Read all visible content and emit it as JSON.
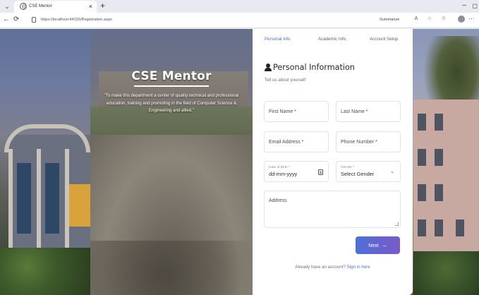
{
  "browser": {
    "tab_title": "CSE Mentor",
    "tab_close": "×",
    "new_tab": "+",
    "url": "https://localhost:44316/Registration.aspx",
    "summarize": "Summarize",
    "minimize": "–",
    "maximize": "◻",
    "back": "←",
    "refresh": "⟳",
    "tab_menu": "⌄",
    "more": "···"
  },
  "hero": {
    "title": "CSE Mentor",
    "tagline": "\"To make this department a center of quality technical and professional education, training and promoting in the field of Computer Science & Engineering and allied.\""
  },
  "steps": [
    "Personal Info",
    "Academic Info",
    "Account Setup"
  ],
  "form": {
    "section_title": "Personal Information",
    "section_subtitle": "Tell us about yourself",
    "first_name": "First Name *",
    "last_name": "Last Name *",
    "email": "Email Address *",
    "phone": "Phone Number *",
    "dob_label": "Date of Birth *",
    "dob_value": "dd-mm-yyyy",
    "gender_label": "Gender *",
    "gender_value": "Select Gender",
    "address": "Address",
    "next_label": "Next",
    "next_arrow": "→",
    "signin_prompt": "Already have an account?",
    "signin_link": "Sign in here"
  },
  "colors": {
    "accent": "#4a6fd6",
    "button_start": "#4f6fd8",
    "button_end": "#7a59c8"
  },
  "icons": [
    "globe-icon",
    "lock-icon",
    "user-icon",
    "calendar-icon",
    "chevron-down-icon",
    "arrow-right-icon"
  ]
}
